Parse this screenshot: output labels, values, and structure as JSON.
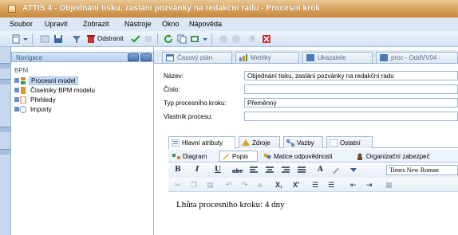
{
  "window": {
    "title": "ATTIS 4 - Objednání tisku, zaslání pozvánky na redakční radu - Procesní krok"
  },
  "menu": [
    "Soubor",
    "Upravit",
    "Zobrazit",
    "Nástroje",
    "Okno",
    "Nápověda"
  ],
  "toolbar": {
    "delete_label": "Odstranit"
  },
  "navigation": {
    "header": "Navigace",
    "section": "BPM",
    "items": [
      {
        "label": "Procesní model",
        "selected": true
      },
      {
        "label": "Číselníky BPM modelu",
        "selected": false
      },
      {
        "label": "Přehledy",
        "selected": false
      },
      {
        "label": "Importy",
        "selected": false
      }
    ]
  },
  "top_tabs": [
    "Časový plán",
    "Metriky",
    "Ukazatele",
    "proc - OddVV04 -"
  ],
  "form": {
    "name_label": "Název:",
    "name_value": "Objednání tisku, zaslání pozvánky na redakční radu",
    "number_label": "Číslo:",
    "number_value": "",
    "type_label": "Typ procesního kroku:",
    "type_value": "Přeměnný",
    "owner_label": "Vlastník procesu:",
    "owner_value": ""
  },
  "detail_tabs": [
    "Hlavní atributy",
    "Zdroje",
    "Vazby",
    "Ostatní"
  ],
  "sub_tabs": [
    "Diagram",
    "Popis",
    "Matice odpovědnosti",
    "Organizační zabezpeč"
  ],
  "active_sub_tab": "Popis",
  "editor": {
    "font": "Times New Roman",
    "text": "Lhůta procesního kroku: 4 dny",
    "format_buttons": [
      "B",
      "I",
      "U",
      "abc",
      "A"
    ]
  },
  "colors": {
    "title_bar": "#d7a15a",
    "menu_bar": "#dbe7f5",
    "selection": "#c6dbf6",
    "border": "#9cb3d1"
  }
}
